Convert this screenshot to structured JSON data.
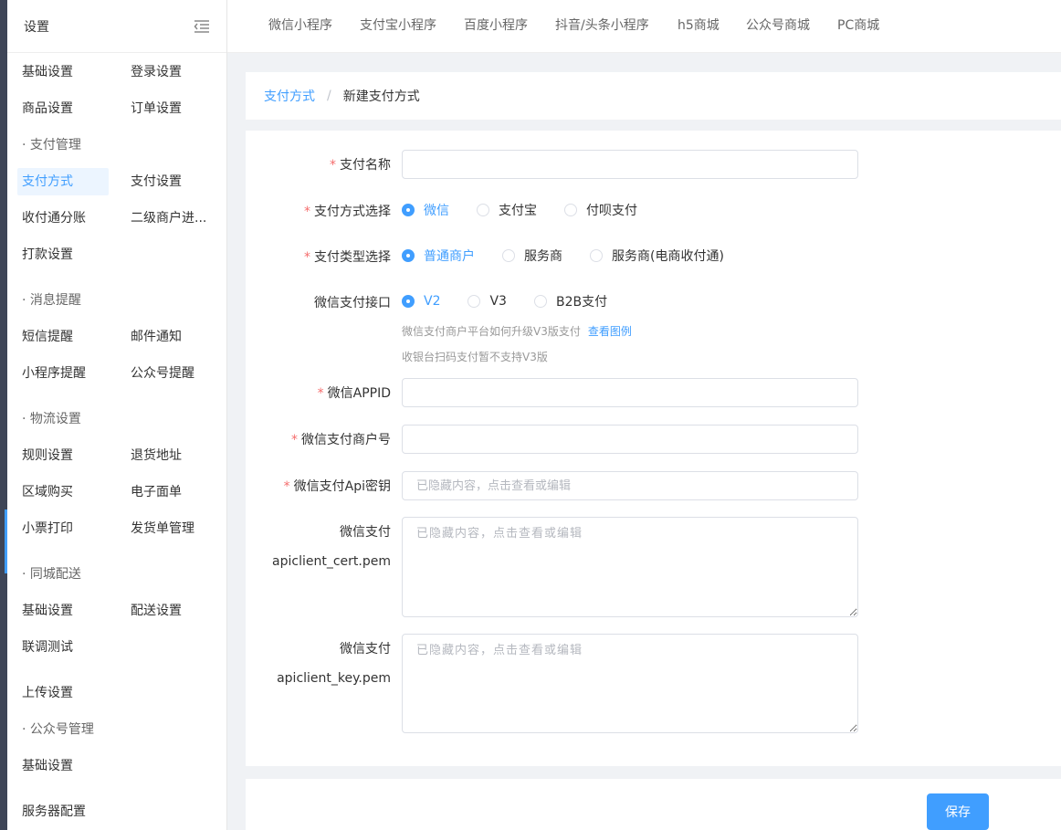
{
  "sidebar": {
    "title": "设置",
    "collapse_icon": "menu-fold-icon",
    "rows": [
      {
        "a": "基础设置",
        "b": "登录设置"
      },
      {
        "a": "商品设置",
        "b": "订单设置"
      },
      {
        "group": "· 支付管理"
      },
      {
        "a": "支付方式",
        "b": "支付设置"
      },
      {
        "a": "收付通分账",
        "b": "二级商户进..."
      },
      {
        "a": "打款设置"
      },
      {
        "group": "· 消息提醒"
      },
      {
        "a": "短信提醒",
        "b": "邮件通知"
      },
      {
        "a": "小程序提醒",
        "b": "公众号提醒"
      },
      {
        "group": "· 物流设置"
      },
      {
        "a": "规则设置",
        "b": "退货地址"
      },
      {
        "a": "区域购买",
        "b": "电子面单"
      },
      {
        "a": "小票打印",
        "b": "发货单管理"
      },
      {
        "group": "· 同城配送"
      },
      {
        "a": "基础设置",
        "b": "配送设置"
      },
      {
        "a": "联调测试"
      },
      {
        "a": "上传设置"
      },
      {
        "group": "· 公众号管理"
      },
      {
        "a": "基础设置"
      },
      {
        "a": "服务器配置"
      }
    ]
  },
  "topnav": {
    "tabs": [
      "微信小程序",
      "支付宝小程序",
      "百度小程序",
      "抖音/头条小程序",
      "h5商城",
      "公众号商城",
      "PC商城"
    ]
  },
  "breadcrumb": {
    "parent": "支付方式",
    "separator": "/",
    "current": "新建支付方式"
  },
  "form": {
    "name": {
      "label": "支付名称",
      "value": ""
    },
    "method": {
      "label": "支付方式选择",
      "options": [
        "微信",
        "支付宝",
        "付呗支付"
      ],
      "selected": "微信"
    },
    "type": {
      "label": "支付类型选择",
      "options": [
        "普通商户",
        "服务商",
        "服务商(电商收付通)"
      ],
      "selected": "普通商户"
    },
    "api_version": {
      "label": "微信支付接口",
      "options": [
        "V2",
        "V3",
        "B2B支付"
      ],
      "selected": "V2"
    },
    "hint1": "微信支付商户平台如何升级V3版支付",
    "hint1_link": "查看图例",
    "hint2": "收银台扫码支付暂不支持V3版",
    "appid": {
      "label": "微信APPID",
      "value": ""
    },
    "mch_id": {
      "label": "微信支付商户号",
      "value": ""
    },
    "api_key": {
      "label": "微信支付Api密钥",
      "placeholder": "已隐藏内容，点击查看或编辑"
    },
    "cert": {
      "label_line1": "微信支付",
      "label_line2": "apiclient_cert.pem",
      "placeholder": "已隐藏内容，点击查看或编辑"
    },
    "key": {
      "label_line1": "微信支付",
      "label_line2": "apiclient_key.pem",
      "placeholder": "已隐藏内容，点击查看或编辑"
    },
    "required_mark": "*"
  },
  "footer": {
    "save_label": "保存"
  },
  "colors": {
    "accent": "#409eff",
    "required": "#f56c6c",
    "rail": "#3e4557"
  }
}
